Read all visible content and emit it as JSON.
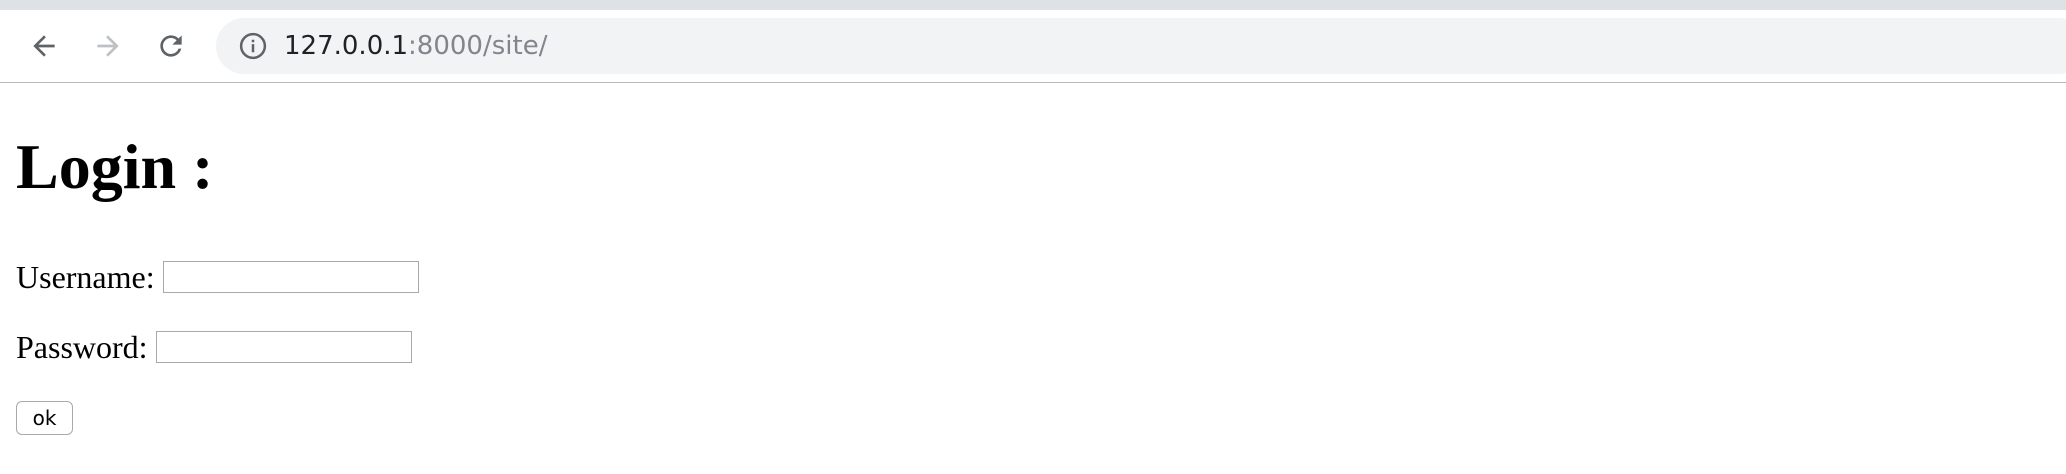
{
  "browser": {
    "toolbar": {
      "back_icon": "arrow-left-icon",
      "forward_icon": "arrow-right-icon",
      "reload_icon": "reload-icon"
    },
    "address_bar": {
      "info_icon": "info-icon",
      "host": "127.0.0.1",
      "rest": ":8000/site/"
    },
    "colors": {
      "tab_strip": "#dee1e6",
      "omnibox_bg": "#f1f3f4",
      "url_host": "#202124",
      "url_rest": "#80868b",
      "forward_disabled": "#bdc1c6"
    }
  },
  "page": {
    "title": "Login :",
    "username_label": "Username:",
    "username_value": "",
    "password_label": "Password:",
    "password_value": "",
    "submit_label": "ok"
  }
}
